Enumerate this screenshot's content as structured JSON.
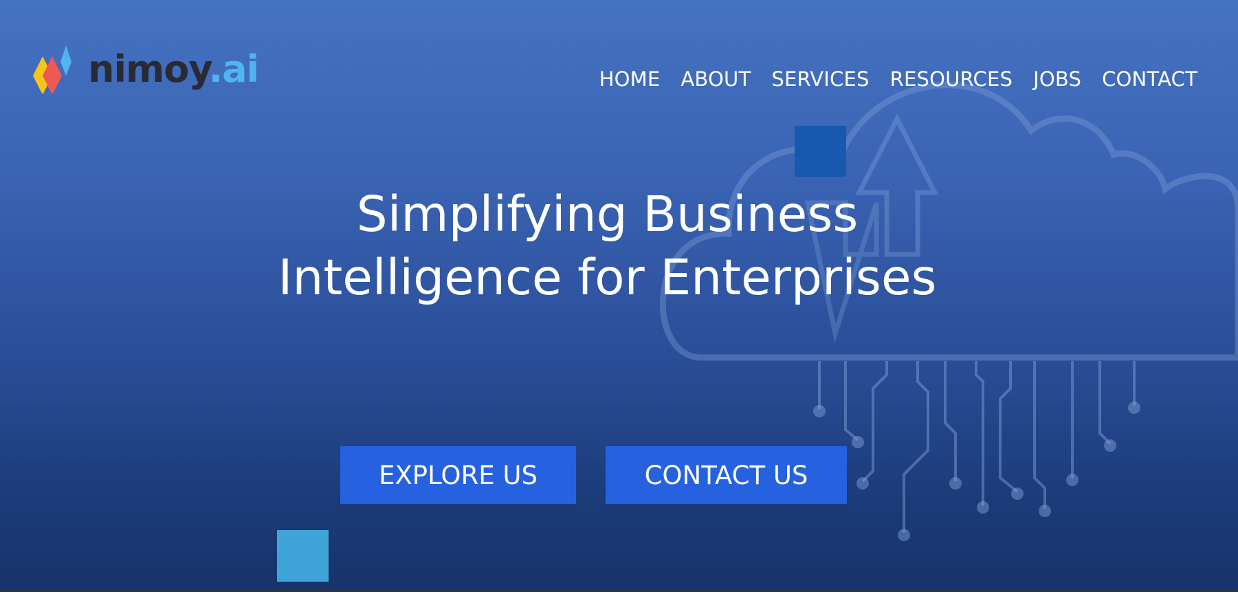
{
  "brand": {
    "name_main": "nimoy",
    "name_suffix": ".ai",
    "logo_icon": "nimoy-logo-mark",
    "text_color": "#2a2a33",
    "accent_color": "#4fb4f0"
  },
  "nav": {
    "items": [
      {
        "label": "HOME"
      },
      {
        "label": "ABOUT"
      },
      {
        "label": "SERVICES"
      },
      {
        "label": "RESOURCES"
      },
      {
        "label": "JOBS"
      },
      {
        "label": "CONTACT"
      }
    ]
  },
  "hero": {
    "headline_line1": "Simplifying Business",
    "headline_line2": "Intelligence for Enterprises",
    "background_art_icon": "cloud-upload-circuit-icon",
    "background_color_top": "#4672c2",
    "background_color_bottom": "#17336b"
  },
  "buttons": {
    "explore_label": "EXPLORE US",
    "contact_label": "CONTACT US",
    "color": "#2662e0"
  },
  "decorations": {
    "square_dark_color": "#1659ae",
    "square_light_color": "#3fa5d9"
  }
}
